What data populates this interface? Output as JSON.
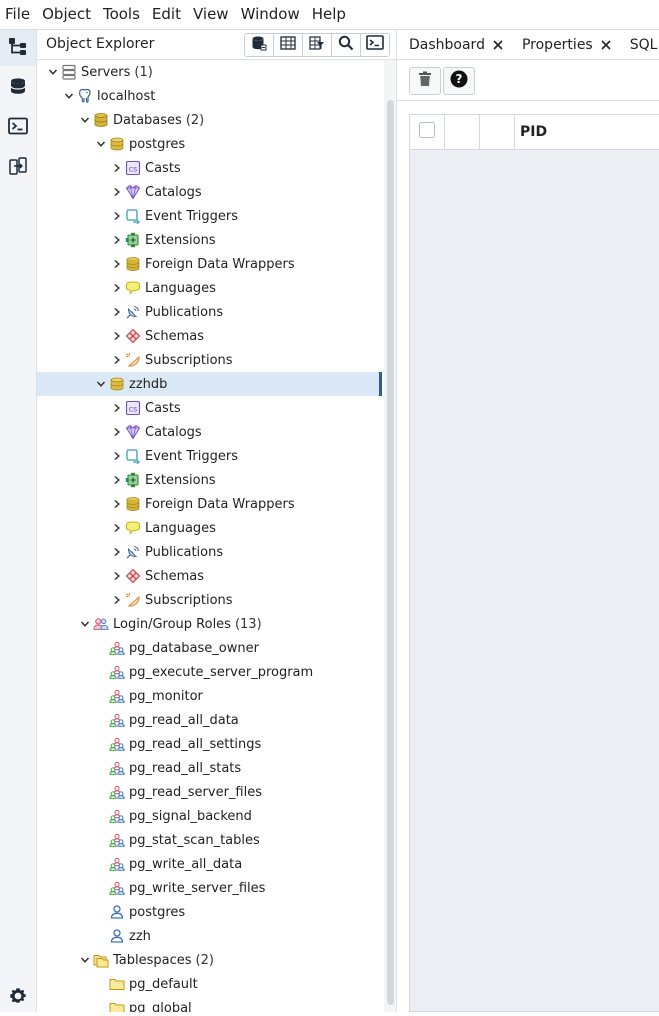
{
  "menubar": {
    "items": [
      "File",
      "Object",
      "Tools",
      "Edit",
      "View",
      "Window",
      "Help"
    ]
  },
  "explorer": {
    "title": "Object Explorer"
  },
  "tree": [
    {
      "label": "Servers",
      "count": "(1)",
      "level": 0,
      "expanded": true,
      "icon": "servers-icon"
    },
    {
      "label": "localhost",
      "count": "",
      "level": 1,
      "expanded": true,
      "icon": "postgres-elephant-icon"
    },
    {
      "label": "Databases",
      "count": "(2)",
      "level": 2,
      "expanded": true,
      "icon": "databases-icon"
    },
    {
      "label": "postgres",
      "count": "",
      "level": 3,
      "expanded": true,
      "icon": "database-icon"
    },
    {
      "label": "Casts",
      "count": "",
      "level": 4,
      "expanded": false,
      "icon": "casts-icon"
    },
    {
      "label": "Catalogs",
      "count": "",
      "level": 4,
      "expanded": false,
      "icon": "catalogs-icon"
    },
    {
      "label": "Event Triggers",
      "count": "",
      "level": 4,
      "expanded": false,
      "icon": "event-triggers-icon"
    },
    {
      "label": "Extensions",
      "count": "",
      "level": 4,
      "expanded": false,
      "icon": "extensions-icon"
    },
    {
      "label": "Foreign Data Wrappers",
      "count": "",
      "level": 4,
      "expanded": false,
      "icon": "foreign-data-wrappers-icon"
    },
    {
      "label": "Languages",
      "count": "",
      "level": 4,
      "expanded": false,
      "icon": "languages-icon"
    },
    {
      "label": "Publications",
      "count": "",
      "level": 4,
      "expanded": false,
      "icon": "publications-icon"
    },
    {
      "label": "Schemas",
      "count": "",
      "level": 4,
      "expanded": false,
      "icon": "schemas-icon"
    },
    {
      "label": "Subscriptions",
      "count": "",
      "level": 4,
      "expanded": false,
      "icon": "subscriptions-icon"
    },
    {
      "label": "zzhdb",
      "count": "",
      "level": 3,
      "expanded": true,
      "icon": "database-icon",
      "selected": true
    },
    {
      "label": "Casts",
      "count": "",
      "level": 4,
      "expanded": false,
      "icon": "casts-icon"
    },
    {
      "label": "Catalogs",
      "count": "",
      "level": 4,
      "expanded": false,
      "icon": "catalogs-icon"
    },
    {
      "label": "Event Triggers",
      "count": "",
      "level": 4,
      "expanded": false,
      "icon": "event-triggers-icon"
    },
    {
      "label": "Extensions",
      "count": "",
      "level": 4,
      "expanded": false,
      "icon": "extensions-icon"
    },
    {
      "label": "Foreign Data Wrappers",
      "count": "",
      "level": 4,
      "expanded": false,
      "icon": "foreign-data-wrappers-icon"
    },
    {
      "label": "Languages",
      "count": "",
      "level": 4,
      "expanded": false,
      "icon": "languages-icon"
    },
    {
      "label": "Publications",
      "count": "",
      "level": 4,
      "expanded": false,
      "icon": "publications-icon"
    },
    {
      "label": "Schemas",
      "count": "",
      "level": 4,
      "expanded": false,
      "icon": "schemas-icon"
    },
    {
      "label": "Subscriptions",
      "count": "",
      "level": 4,
      "expanded": false,
      "icon": "subscriptions-icon"
    },
    {
      "label": "Login/Group Roles",
      "count": "(13)",
      "level": 2,
      "expanded": true,
      "icon": "roles-icon"
    },
    {
      "label": "pg_database_owner",
      "count": "",
      "level": 3,
      "leaf": true,
      "icon": "group-role-icon"
    },
    {
      "label": "pg_execute_server_program",
      "count": "",
      "level": 3,
      "leaf": true,
      "icon": "group-role-icon"
    },
    {
      "label": "pg_monitor",
      "count": "",
      "level": 3,
      "leaf": true,
      "icon": "group-role-icon"
    },
    {
      "label": "pg_read_all_data",
      "count": "",
      "level": 3,
      "leaf": true,
      "icon": "group-role-icon"
    },
    {
      "label": "pg_read_all_settings",
      "count": "",
      "level": 3,
      "leaf": true,
      "icon": "group-role-icon"
    },
    {
      "label": "pg_read_all_stats",
      "count": "",
      "level": 3,
      "leaf": true,
      "icon": "group-role-icon"
    },
    {
      "label": "pg_read_server_files",
      "count": "",
      "level": 3,
      "leaf": true,
      "icon": "group-role-icon"
    },
    {
      "label": "pg_signal_backend",
      "count": "",
      "level": 3,
      "leaf": true,
      "icon": "group-role-icon"
    },
    {
      "label": "pg_stat_scan_tables",
      "count": "",
      "level": 3,
      "leaf": true,
      "icon": "group-role-icon"
    },
    {
      "label": "pg_write_all_data",
      "count": "",
      "level": 3,
      "leaf": true,
      "icon": "group-role-icon"
    },
    {
      "label": "pg_write_server_files",
      "count": "",
      "level": 3,
      "leaf": true,
      "icon": "group-role-icon"
    },
    {
      "label": "postgres",
      "count": "",
      "level": 3,
      "leaf": true,
      "icon": "login-role-icon"
    },
    {
      "label": "zzh",
      "count": "",
      "level": 3,
      "leaf": true,
      "icon": "login-role-icon"
    },
    {
      "label": "Tablespaces",
      "count": "(2)",
      "level": 2,
      "expanded": true,
      "icon": "tablespaces-icon"
    },
    {
      "label": "pg_default",
      "count": "",
      "level": 3,
      "leaf": true,
      "icon": "tablespace-icon"
    },
    {
      "label": "pg_global",
      "count": "",
      "level": 3,
      "leaf": true,
      "icon": "tablespace-icon"
    }
  ],
  "tabs": [
    {
      "label": "Dashboard"
    },
    {
      "label": "Properties"
    },
    {
      "label": "SQL"
    }
  ],
  "grid": {
    "column_pid": "PID"
  },
  "colors": {
    "selected_row": "#dbe9f6",
    "selected_marker": "#2c5f8e",
    "accent_blue": "#326690"
  }
}
